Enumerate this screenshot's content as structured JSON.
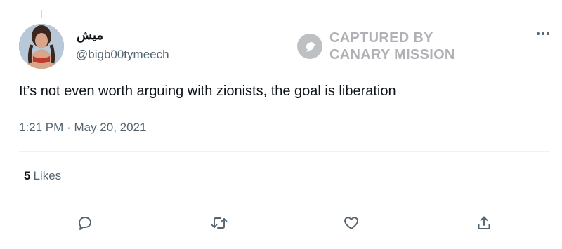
{
  "author": {
    "display_name": "ميش",
    "handle": "@bigb00tymeech"
  },
  "watermark": {
    "line1": "CAPTURED BY",
    "line2": "CANARY MISSION"
  },
  "tweet": {
    "text": "It’s not even worth arguing with zionists, the goal is liberation",
    "time": "1:21 PM",
    "separator": "·",
    "date": "May 20, 2021"
  },
  "stats": {
    "likes_count": "5",
    "likes_label": "Likes"
  },
  "actions": {
    "icons": [
      "reply-icon",
      "retweet-icon",
      "like-icon",
      "share-icon"
    ]
  },
  "colors": {
    "text_primary": "#0f1419",
    "text_secondary": "#536471",
    "divider": "#eff3f4"
  }
}
